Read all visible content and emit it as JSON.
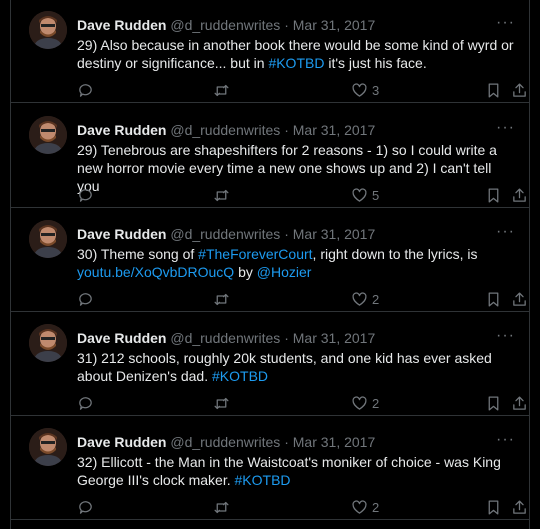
{
  "tweets": [
    {
      "author": "Dave Rudden",
      "handle": "@d_ruddenwrites",
      "sep": "·",
      "date": "Mar 31, 2017",
      "text": [
        {
          "t": "29) Also because in another book there would be some kind of wyrd or destiny or significance... but in "
        },
        {
          "t": "#KOTBD",
          "link": true
        },
        {
          "t": " it's just his face."
        }
      ],
      "likes": "3"
    },
    {
      "author": "Dave Rudden",
      "handle": "@d_ruddenwrites",
      "sep": "·",
      "date": "Mar 31, 2017",
      "text": [
        {
          "t": "29) Tenebrous are shapeshifters for 2 reasons - 1) so I could write a new horror movie every time a new one shows up and 2) I can't tell you"
        }
      ],
      "likes": "5"
    },
    {
      "author": "Dave Rudden",
      "handle": "@d_ruddenwrites",
      "sep": "·",
      "date": "Mar 31, 2017",
      "text": [
        {
          "t": "30) Theme song of "
        },
        {
          "t": "#TheForeverCourt",
          "link": true
        },
        {
          "t": ", right down to the lyrics, is "
        },
        {
          "t": "youtu.be/XoQvbDROucQ",
          "link": true
        },
        {
          "t": " by "
        },
        {
          "t": "@Hozier",
          "link": true
        }
      ],
      "likes": "2"
    },
    {
      "author": "Dave Rudden",
      "handle": "@d_ruddenwrites",
      "sep": "·",
      "date": "Mar 31, 2017",
      "text": [
        {
          "t": "31) 212 schools, roughly 20k students, and one kid has ever asked about Denizen's dad. "
        },
        {
          "t": "#KOTBD",
          "link": true
        }
      ],
      "likes": "2"
    },
    {
      "author": "Dave Rudden",
      "handle": "@d_ruddenwrites",
      "sep": "·",
      "date": "Mar 31, 2017",
      "text": [
        {
          "t": "32) Ellicott - the Man in the Waistcoat's moniker of choice - was King George III's clock maker. "
        },
        {
          "t": "#KOTBD",
          "link": true
        }
      ],
      "likes": "2"
    }
  ],
  "icons": {
    "more": "more-icon",
    "reply": "reply-icon",
    "retweet": "retweet-icon",
    "like": "heart-icon",
    "bookmark": "bookmark-icon",
    "share": "share-icon"
  },
  "colors": {
    "background": "#000000",
    "text": "#e7e9ea",
    "muted": "#71767b",
    "link": "#1d9bf0",
    "border": "#2f3336"
  }
}
